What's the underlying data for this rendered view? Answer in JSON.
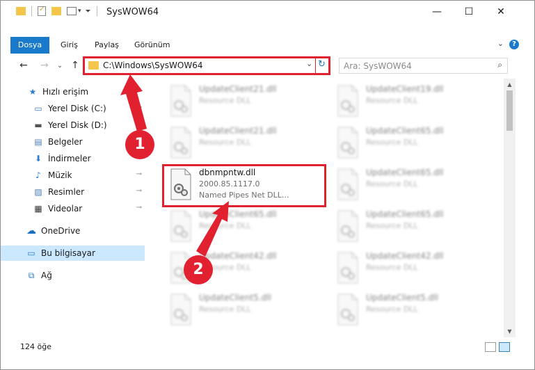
{
  "window": {
    "title": "SysWOW64",
    "minimize_glyph": "—",
    "maximize_glyph": "☐",
    "close_glyph": "✕"
  },
  "ribbon": {
    "tabs": [
      {
        "label": "Dosya",
        "active": true
      },
      {
        "label": "Giriş"
      },
      {
        "label": "Paylaş"
      },
      {
        "label": "Görünüm"
      }
    ],
    "collapse_glyph": "⌄",
    "help_glyph": "?"
  },
  "address": {
    "path": "C:\\Windows\\SysWOW64",
    "dropdown_glyph": "⌄",
    "refresh_glyph": "↻"
  },
  "nav_buttons": {
    "back": "←",
    "forward": "→",
    "recent": "⌄",
    "up": "↑"
  },
  "search": {
    "placeholder": "Ara: SysWOW64",
    "icon": "⌕"
  },
  "navpane": {
    "items": [
      {
        "label": "Hızlı erişim",
        "icon": "star-icon",
        "glyph": "★",
        "color": "#2b7cd3"
      },
      {
        "label": "Yerel Disk (C:)",
        "icon": "drive-icon",
        "glyph": "▭",
        "color": "#3a7bbf",
        "pin": "📌"
      },
      {
        "label": "Yerel Disk (D:)",
        "icon": "drive-icon",
        "glyph": "▬",
        "color": "#555555",
        "pin": "📌"
      },
      {
        "label": "Belgeler",
        "icon": "document-icon",
        "glyph": "▤",
        "color": "#4a7bb7",
        "pin": "📌"
      },
      {
        "label": "İndirmeler",
        "icon": "download-icon",
        "glyph": "⬇",
        "color": "#2b7cd3",
        "pin": "📌"
      },
      {
        "label": "Müzik",
        "icon": "music-icon",
        "glyph": "♪",
        "color": "#2b7cd3",
        "pin": "📌"
      },
      {
        "label": "Resimler",
        "icon": "pictures-icon",
        "glyph": "▨",
        "color": "#4a7bb7",
        "pin": "📌"
      },
      {
        "label": "Videolar",
        "icon": "video-icon",
        "glyph": "▦",
        "color": "#333333",
        "pin": "📌"
      },
      {
        "label": "OneDrive",
        "icon": "cloud-icon",
        "glyph": "☁",
        "color": "#1b6fc2"
      },
      {
        "label": "Bu bilgisayar",
        "icon": "computer-icon",
        "glyph": "▭",
        "color": "#2b7cd3",
        "selected": true
      },
      {
        "label": "Ağ",
        "icon": "network-icon",
        "glyph": "⧉",
        "color": "#2b7cd3"
      }
    ]
  },
  "files": [
    {
      "name": "UpdateClient21.dll",
      "desc": "Resource DLL",
      "blurred": true
    },
    {
      "name": "UpdateClient19.dll",
      "desc": "Resource DLL",
      "blurred": true
    },
    {
      "name": "UpdateClient21.dll",
      "desc": "Resource DLL",
      "blurred": true
    },
    {
      "name": "UpdateClient65.dll",
      "desc": "Resource DLL",
      "blurred": true
    },
    {
      "name": "dbnmpntw.dll",
      "version": "2000.85.1117.0",
      "desc": "Named Pipes Net DLL...",
      "highlighted": true
    },
    {
      "name": "UpdateClient65.dll",
      "desc": "Resource DLL",
      "blurred": true
    },
    {
      "name": "UpdateClient65.dll",
      "desc": "Resource DLL",
      "blurred": true
    },
    {
      "name": "UpdateClient65.dll",
      "desc": "Resource DLL",
      "blurred": true
    },
    {
      "name": "UpdateClient42.dll",
      "desc": "Resource DLL",
      "blurred": true
    },
    {
      "name": "UpdateClient42.dll",
      "desc": "Resource DLL",
      "blurred": true
    },
    {
      "name": "UpdateClient5.dll",
      "desc": "Resource DLL",
      "blurred": true
    },
    {
      "name": "UpdateClient5.dll",
      "desc": "Resource DLL",
      "blurred": true
    }
  ],
  "status": {
    "count": "124 öğe"
  },
  "annotations": [
    {
      "label": "1"
    },
    {
      "label": "2"
    }
  ],
  "colors": {
    "accent": "#1979ca",
    "annotation": "#e1212f",
    "selection": "#cce8ff"
  }
}
